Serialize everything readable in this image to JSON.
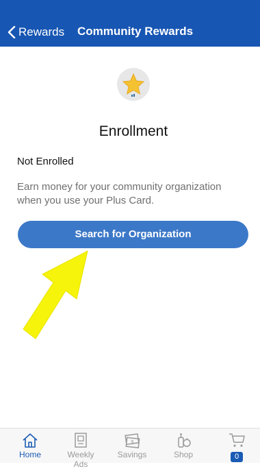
{
  "header": {
    "back_label": "Rewards",
    "title": "Community Rewards"
  },
  "enrollment": {
    "title": "Enrollment",
    "status": "Not Enrolled",
    "description": "Earn money for your community organization when you use your Plus Card.",
    "search_button": "Search for Organization"
  },
  "tabbar": {
    "tabs": [
      {
        "label": "Home",
        "icon": "home-icon",
        "active": true
      },
      {
        "label": "Weekly Ads",
        "icon": "weekly-ads-icon",
        "active": false
      },
      {
        "label": "Savings",
        "icon": "savings-icon",
        "active": false
      },
      {
        "label": "Shop",
        "icon": "shop-icon",
        "active": false
      },
      {
        "label": "",
        "icon": "cart-icon",
        "active": false
      }
    ],
    "cart_count": "0"
  },
  "colors": {
    "header_bg": "#1756b3",
    "button_bg": "#3c78c8",
    "accent": "#1a5bb4",
    "arrow": "#f6f40a",
    "star": "#f5c232"
  }
}
